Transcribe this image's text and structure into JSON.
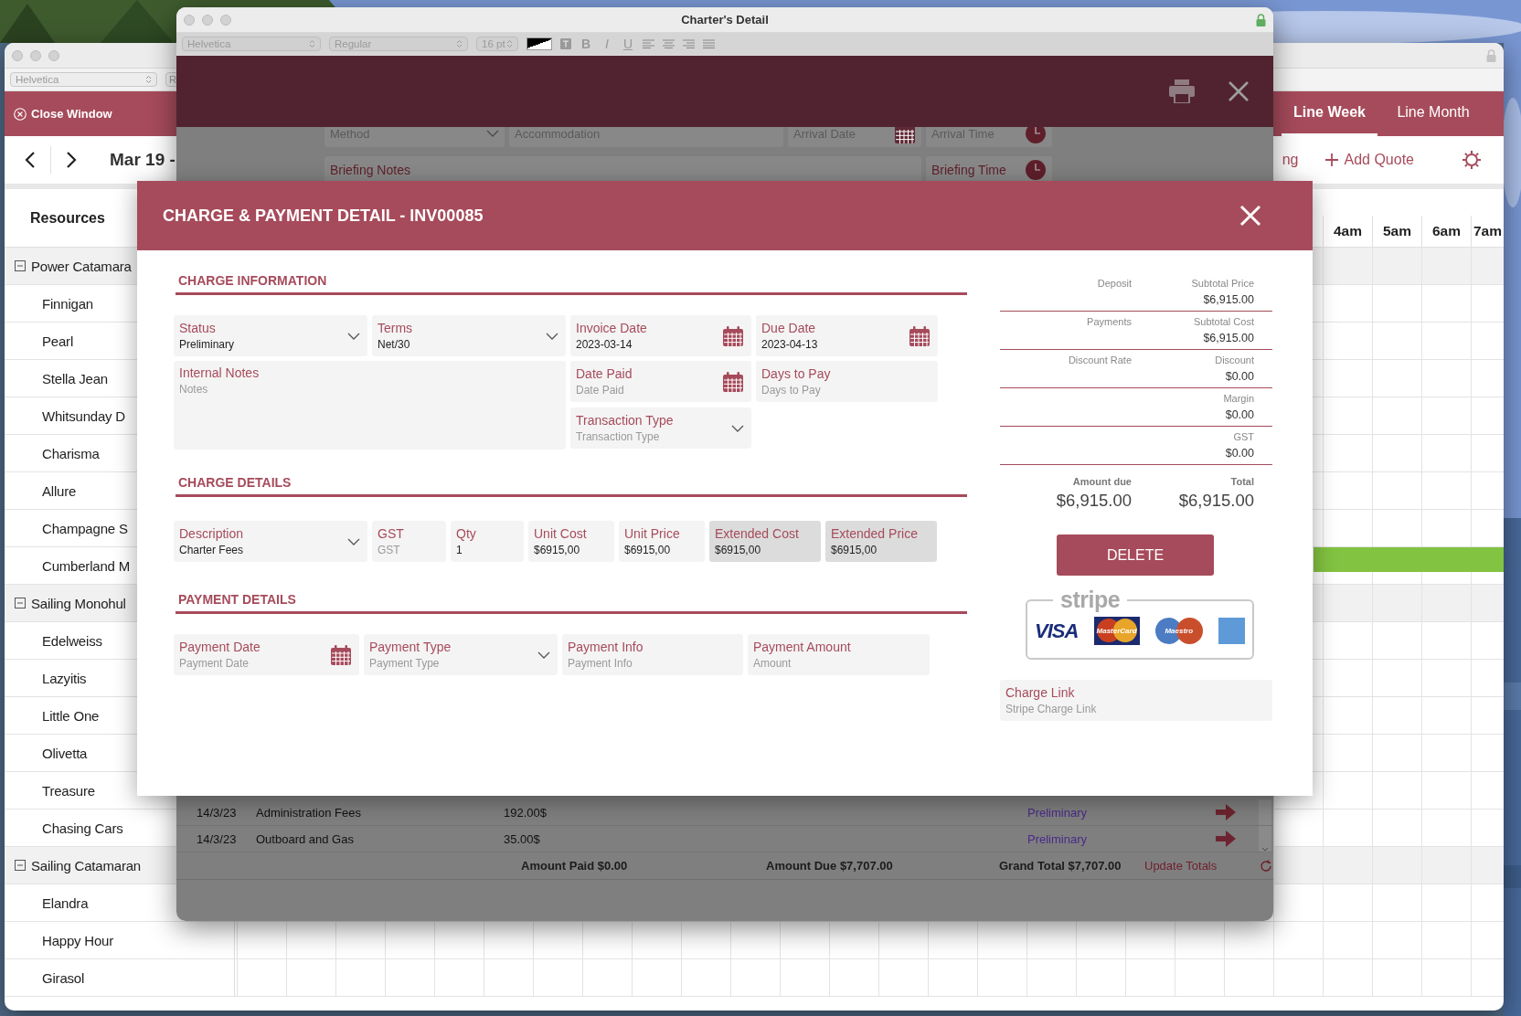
{
  "calendar_window": {
    "font_field": "Helvetica",
    "style_field": "R",
    "close_button": "Close Window",
    "view_tabs": [
      {
        "label": "Line Week",
        "selected": true
      },
      {
        "label": "Line Month",
        "selected": false
      }
    ],
    "date_range": "Mar 19 -",
    "partial_link": "ng",
    "add_quote": "Add Quote",
    "resources_header": "Resources",
    "hours": [
      "4am",
      "5am",
      "6am",
      "7am"
    ],
    "groups": [
      {
        "label": "Power Catamara",
        "expanded": true,
        "children": [
          {
            "label": "Finnigan",
            "booked": false
          },
          {
            "label": "Pearl",
            "booked": false
          },
          {
            "label": "Stella Jean",
            "booked": false
          },
          {
            "label": "Whitsunday D",
            "booked": false
          },
          {
            "label": "Charisma",
            "booked": false
          },
          {
            "label": "Allure",
            "booked": false
          },
          {
            "label": "Champagne S",
            "booked": false
          },
          {
            "label": "Cumberland M",
            "booked": true
          }
        ]
      },
      {
        "label": "Sailing Monohul",
        "expanded": true,
        "children": [
          {
            "label": "Edelweiss",
            "booked": false
          },
          {
            "label": "Lazyitis",
            "booked": false
          },
          {
            "label": "Little One",
            "booked": false
          },
          {
            "label": "Olivetta",
            "booked": false
          },
          {
            "label": "Treasure",
            "booked": false
          },
          {
            "label": "Chasing Cars",
            "booked": false
          }
        ]
      },
      {
        "label": "Sailing Catamaran",
        "expanded": true,
        "children": [
          {
            "label": "Elandra",
            "booked": false
          },
          {
            "label": "Happy Hour",
            "booked": false
          },
          {
            "label": "Girasol",
            "booked": false
          }
        ]
      }
    ]
  },
  "charter_window": {
    "title": "Charter's Detail",
    "format_bar": {
      "font": "Helvetica",
      "style": "Regular",
      "size": "16 pt",
      "bold": "B",
      "italic": "I",
      "underline": "U"
    },
    "top_fields": [
      {
        "placeholder": "Method",
        "kind": "select"
      },
      {
        "placeholder": "Accommodation",
        "kind": "text"
      },
      {
        "placeholder": "Arrival Date",
        "kind": "date"
      },
      {
        "placeholder": "Arrival Time",
        "kind": "time"
      }
    ],
    "briefing_fields": [
      {
        "label": "Briefing Notes",
        "kind": "text"
      },
      {
        "label": "Briefing Time",
        "kind": "time"
      }
    ],
    "charges": [
      {
        "date": "14/3/23",
        "description": "Administration Fees",
        "amount": "192.00$",
        "status": "Preliminary"
      },
      {
        "date": "14/3/23",
        "description": "Outboard and Gas",
        "amount": "35.00$",
        "status": "Preliminary"
      }
    ],
    "totals": {
      "amount_paid": "Amount Paid $0.00",
      "amount_due": "Amount Due $7,707.00",
      "grand_total": "Grand Total $7,707.00",
      "update_link": "Update Totals"
    }
  },
  "modal": {
    "title": "CHARGE & PAYMENT DETAIL - INV00085",
    "charge_information": {
      "title": "CHARGE INFORMATION",
      "fields": [
        {
          "label": "Status",
          "value": "Preliminary",
          "kind": "select"
        },
        {
          "label": "Terms",
          "value": "Net/30",
          "kind": "select"
        },
        {
          "label": "Invoice Date",
          "value": "2023-03-14",
          "kind": "date"
        },
        {
          "label": "Due Date",
          "value": "2023-04-13",
          "kind": "date"
        },
        {
          "label": "Internal Notes",
          "placeholder": "Notes",
          "kind": "notes"
        },
        {
          "label": "Date Paid",
          "placeholder": "Date Paid",
          "kind": "date"
        },
        {
          "label": "Days to Pay",
          "placeholder": "Days to Pay",
          "kind": "text"
        },
        {
          "label": "Transaction Type",
          "placeholder": "Transaction Type",
          "kind": "select"
        }
      ]
    },
    "charge_details": {
      "title": "CHARGE DETAILS",
      "fields": [
        {
          "label": "Description",
          "value": "Charter Fees",
          "kind": "select"
        },
        {
          "label": "GST",
          "placeholder": "GST",
          "kind": "text"
        },
        {
          "label": "Qty",
          "value": "1",
          "kind": "text"
        },
        {
          "label": "Unit Cost",
          "value": "$6915,00",
          "kind": "text"
        },
        {
          "label": "Unit Price",
          "value": "$6915,00",
          "kind": "text"
        },
        {
          "label": "Extended Cost",
          "value": "$6915,00",
          "kind": "readonly"
        },
        {
          "label": "Extended Price",
          "value": "$6915,00",
          "kind": "readonly"
        }
      ]
    },
    "payment_details": {
      "title": "PAYMENT DETAILS",
      "fields": [
        {
          "label": "Payment Date",
          "placeholder": "Payment Date",
          "kind": "date"
        },
        {
          "label": "Payment Type",
          "placeholder": "Payment Type",
          "kind": "select"
        },
        {
          "label": "Payment Info",
          "placeholder": "Payment Info",
          "kind": "text"
        },
        {
          "label": "Payment Amount",
          "placeholder": "Amount",
          "kind": "text"
        }
      ]
    },
    "summary": [
      {
        "left_label": "Deposit",
        "right_label": "Subtotal Price",
        "value": "$6,915.00"
      },
      {
        "left_label": "Payments",
        "right_label": "Subtotal Cost",
        "value": "$6,915.00"
      },
      {
        "left_label": "Discount Rate",
        "right_label": "Discount",
        "value": "$0.00"
      },
      {
        "right_label": "Margin",
        "value": "$0.00"
      },
      {
        "right_label": "GST",
        "value": "$0.00"
      }
    ],
    "amount_due": {
      "label": "Amount due",
      "value": "$6,915.00"
    },
    "total": {
      "label": "Total",
      "value": "$6,915.00"
    },
    "delete_button": "DELETE",
    "payment_badge": {
      "brand": "stripe",
      "cards": [
        "VISA",
        "MasterCard",
        "Maestro"
      ]
    },
    "charge_link": {
      "label": "Charge Link",
      "placeholder": "Stripe Charge Link"
    }
  }
}
